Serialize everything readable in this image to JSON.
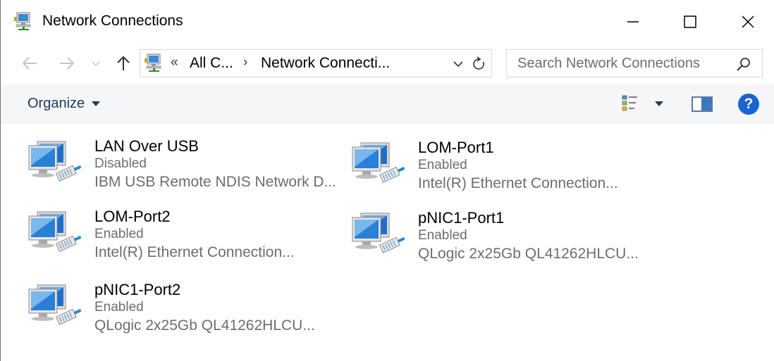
{
  "window": {
    "title": "Network Connections",
    "controls": {
      "minimize": "minimize-icon",
      "maximize": "maximize-icon",
      "close": "close-icon"
    }
  },
  "navigation": {
    "back_icon": "arrow-left-icon",
    "forward_icon": "arrow-right-icon",
    "recent_icon": "chevron-down-icon",
    "up_icon": "arrow-up-icon"
  },
  "address": {
    "overflow": "«",
    "breadcrumbs": [
      "All C...",
      "Network Connecti..."
    ],
    "separator": "›"
  },
  "search": {
    "placeholder": "Search Network Connections"
  },
  "command_bar": {
    "organize_label": "Organize"
  },
  "connections": [
    {
      "name": "LAN Over USB",
      "status": "Disabled",
      "device": "IBM USB Remote NDIS Network D..."
    },
    {
      "name": "LOM-Port1",
      "status": "Enabled",
      "device": "Intel(R) Ethernet Connection..."
    },
    {
      "name": "LOM-Port2",
      "status": "Enabled",
      "device": "Intel(R) Ethernet Connection..."
    },
    {
      "name": "pNIC1-Port1",
      "status": "Enabled",
      "device": "QLogic 2x25Gb QL41262HLCU..."
    },
    {
      "name": "pNIC1-Port2",
      "status": "Enabled",
      "device": "QLogic 2x25Gb QL41262HLCU..."
    }
  ],
  "colors": {
    "accent": "#1b63d0",
    "organize_text": "#1e395b",
    "secondary_text": "#6d6d6d",
    "command_bar_bg": "#f5f6f7"
  }
}
